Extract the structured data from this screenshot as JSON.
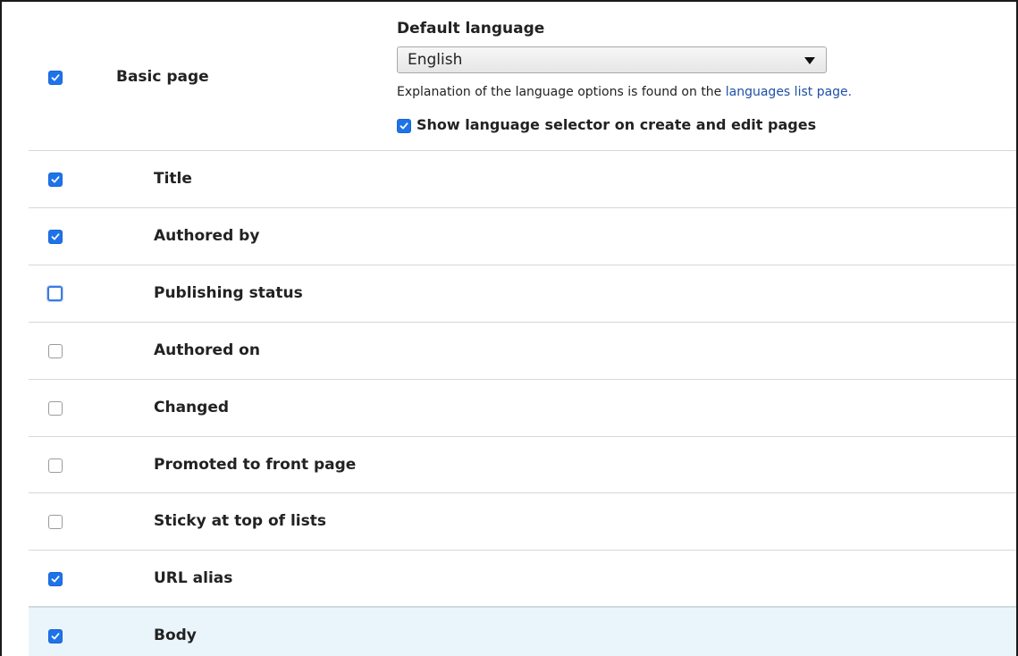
{
  "content_type": {
    "label": "Basic page",
    "checked": true,
    "default_language": {
      "heading": "Default language",
      "selected": "English"
    },
    "description": {
      "text": "Explanation of the language options is found on the ",
      "link": "languages list page."
    },
    "show_selector": {
      "checked": true,
      "label": "Show language selector on create and edit pages"
    }
  },
  "fields": [
    {
      "label": "Title",
      "checked": true
    },
    {
      "label": "Authored by",
      "checked": true
    },
    {
      "label": "Publishing status",
      "checked": false
    },
    {
      "label": "Authored on",
      "checked": false
    },
    {
      "label": "Changed",
      "checked": false
    },
    {
      "label": "Promoted to front page",
      "checked": false
    },
    {
      "label": "Sticky at top of lists",
      "checked": false
    },
    {
      "label": "URL alias",
      "checked": true
    },
    {
      "label": "Body",
      "checked": true
    }
  ],
  "colors": {
    "checkbox_checked": "#1e73e8",
    "link": "#1f4fa5",
    "highlight_row": "#eaf5fb"
  }
}
